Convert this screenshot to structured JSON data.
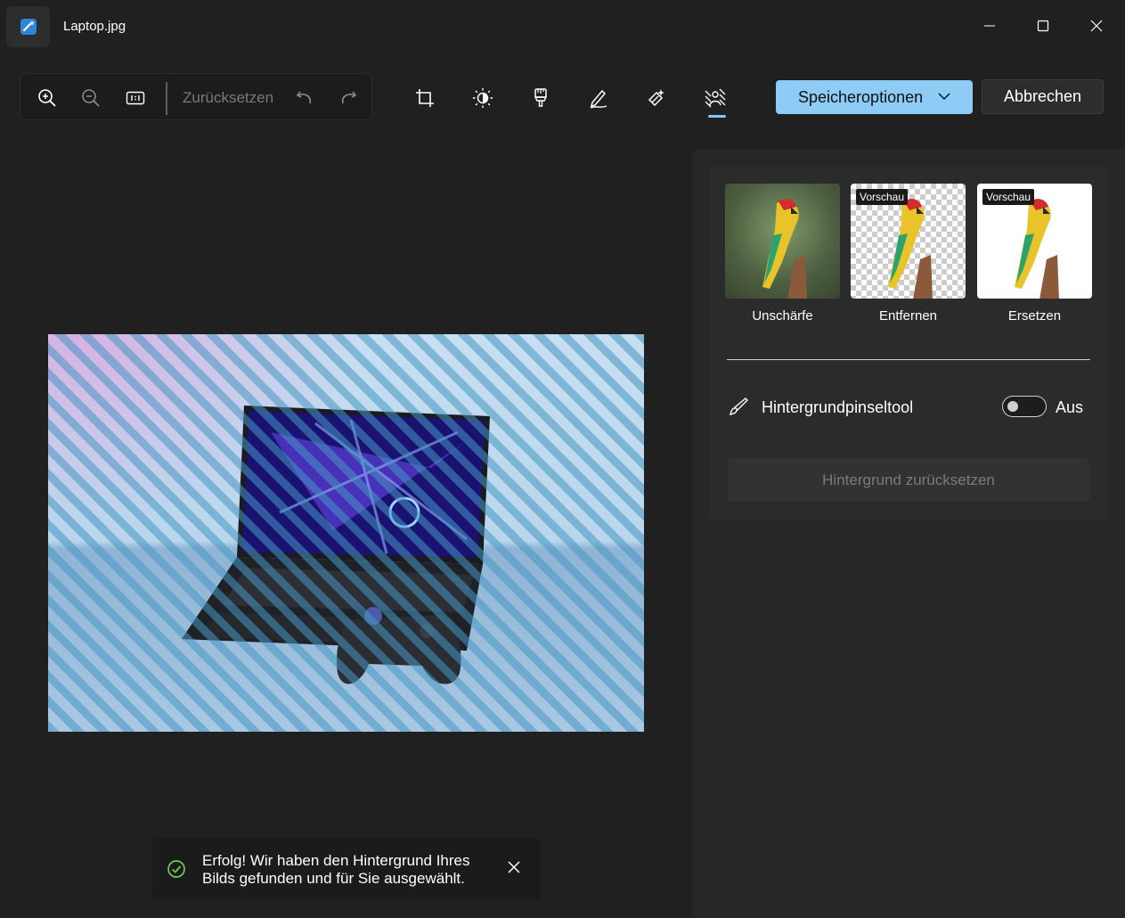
{
  "window": {
    "title": "Laptop.jpg",
    "icons": [
      "photos-app-icon",
      "minimize-icon",
      "maximize-icon",
      "close-icon"
    ]
  },
  "zoom_toolbar": {
    "reset_label": "Zurücksetzen",
    "icons": [
      "zoom-in-icon",
      "zoom-out-icon",
      "actual-size-icon",
      "undo-icon",
      "redo-icon"
    ]
  },
  "tools": {
    "items": [
      "crop-icon",
      "adjust-icon",
      "filter-icon",
      "markup-icon",
      "erase-icon",
      "background-icon"
    ],
    "active": "background-icon",
    "accent": "#8cc5f1"
  },
  "actions": {
    "save_label": "Speicheroptionen",
    "cancel_label": "Abbrechen",
    "save_color": "#8ecbf5"
  },
  "background_panel": {
    "options": [
      {
        "label": "Unschärfe",
        "badge": ""
      },
      {
        "label": "Entfernen",
        "badge": "Vorschau"
      },
      {
        "label": "Ersetzen",
        "badge": "Vorschau"
      }
    ],
    "brush_tool_label": "Hintergrundpinseltool",
    "brush_toggle_state": "Aus",
    "brush_toggle_on": false,
    "reset_button_label": "Hintergrund zurücksetzen"
  },
  "toast": {
    "message": "Erfolg! Wir haben den Hintergrund Ihres Bilds gefunden und für Sie ausgewählt.",
    "icon": "success-check-icon",
    "status_color": "#6ccb5f"
  }
}
